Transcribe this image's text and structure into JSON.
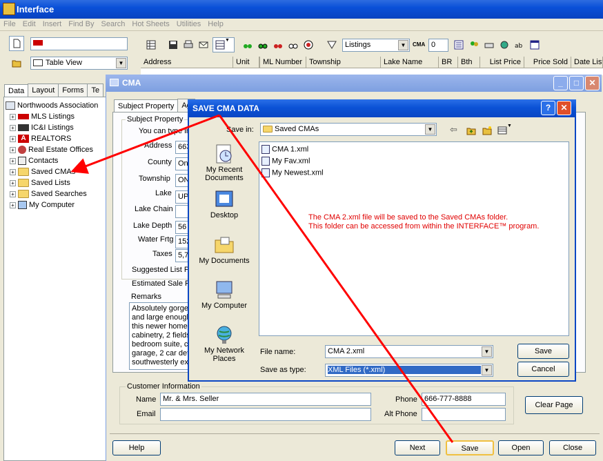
{
  "app": {
    "title": "Interface"
  },
  "menu": [
    "File",
    "Edit",
    "Insert",
    "Find By",
    "Search",
    "Hot Sheets",
    "Utilities",
    "Help"
  ],
  "left_panel": {
    "view_select": "Table View",
    "tabs": [
      "Data",
      "Layout",
      "Forms",
      "Te"
    ],
    "tree": [
      "Northwoods Association",
      "MLS Listings",
      "IC&I Listings",
      "REALTORS",
      "Real Estate Offices",
      "Contacts",
      "Saved CMAs",
      "Saved Lists",
      "Saved Searches",
      "My Computer"
    ]
  },
  "toolbar": {
    "listings_select": "Listings",
    "cma_label": "CMA",
    "count_value": "0"
  },
  "columns": [
    "Address",
    "Unit",
    "ML Number",
    "Township",
    "Lake Name",
    "BR",
    "Bth",
    "List Price",
    "Price Sold",
    "Date List"
  ],
  "cma": {
    "title": "CMA",
    "tabs": [
      "Subject Property",
      "Ag"
    ],
    "group_label": "Subject Property",
    "hint": "You can type in",
    "fields": [
      {
        "label": "Address",
        "value": "663"
      },
      {
        "label": "County",
        "value": "On"
      },
      {
        "label": "Township",
        "value": "ON"
      },
      {
        "label": "Lake",
        "value": "UP"
      },
      {
        "label": "Lake Chain",
        "value": ""
      },
      {
        "label": "Lake Depth",
        "value": "56"
      },
      {
        "label": "Water Frtg",
        "value": "152"
      },
      {
        "label": "Taxes",
        "value": "5,7"
      }
    ],
    "suggested_label": "Suggested List P",
    "estimated_label": "Estimated Sale P",
    "remarks_label": "Remarks",
    "remarks_lines": [
      "Absolutely gorged",
      "and large enough",
      "this newer home",
      "cabinetry, 2 fields",
      "bedroom suite, ce",
      "garage, 2 car det",
      "southwesterly exp"
    ],
    "customer": {
      "group_label": "Customer Information",
      "name_label": "Name",
      "name_value": "Mr. & Mrs. Seller",
      "email_label": "Email",
      "email_value": "",
      "phone_label": "Phone",
      "phone_value": "666-777-8888",
      "alt_phone_label": "Alt Phone",
      "alt_phone_value": ""
    },
    "buttons": {
      "clear": "Clear Page",
      "help": "Help",
      "next": "Next",
      "save": "Save",
      "open": "Open",
      "close": "Close"
    }
  },
  "dialog": {
    "title": "SAVE CMA DATA",
    "save_in_label": "Save in:",
    "save_in_value": "Saved CMAs",
    "places": [
      "My Recent Documents",
      "Desktop",
      "My Documents",
      "My Computer",
      "My Network Places"
    ],
    "files": [
      "CMA 1.xml",
      "My Fav.xml",
      "My Newest.xml"
    ],
    "note_line1": "The CMA 2.xml file will be saved to the Saved CMAs folder.",
    "note_line2": "This folder can be accessed from within the INTERFACE™ program.",
    "file_name_label": "File name:",
    "file_name_value": "CMA 2.xml",
    "type_label": "Save as type:",
    "type_value": "XML Files (*.xml)",
    "save_button": "Save",
    "cancel_button": "Cancel"
  },
  "colors": {
    "annotation": "#ff0000",
    "xp_blue": "#0a50d8"
  }
}
